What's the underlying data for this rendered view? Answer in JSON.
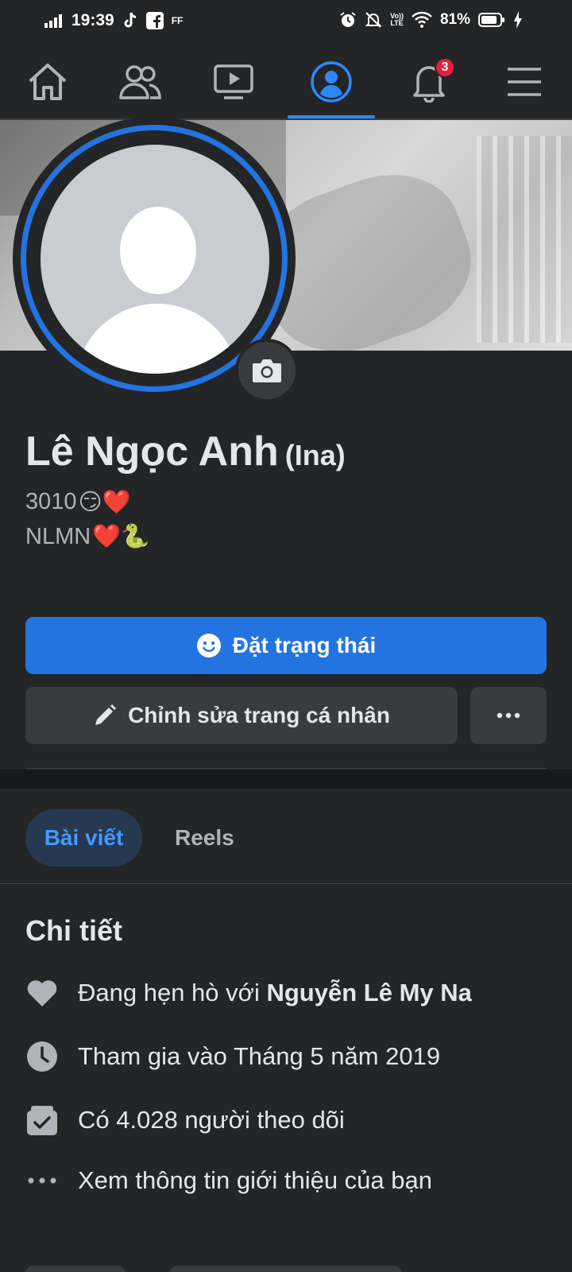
{
  "status_bar": {
    "time": "19:39",
    "app_badge": "FF",
    "network": "LTE",
    "battery": "81%"
  },
  "nav": {
    "notifications_count": "3",
    "active_tab": "profile"
  },
  "profile": {
    "name": "Lê Ngọc Anh",
    "alt_name": "(Ina)",
    "bio_line1_text": "3010",
    "bio_line1_emoji": "😏❤️",
    "bio_line2_text": "NLMN",
    "bio_line2_emoji": "❤️🐍"
  },
  "actions": {
    "primary_label": "Đặt trạng thái",
    "edit_label": "Chỉnh sửa trang cá nhân"
  },
  "tabs": {
    "posts": "Bài viết",
    "reels": "Reels"
  },
  "details": {
    "title": "Chi tiết",
    "relationship_prefix": "Đang hẹn hò với ",
    "relationship_name": "Nguyễn Lê My Na",
    "joined": "Tham gia vào Tháng 5 năm 2019",
    "followers": "Có 4.028 người theo dõi",
    "see_about": "Xem thông tin giới thiệu của bạn"
  },
  "colors": {
    "accent": "#2374e1",
    "background": "#242526",
    "badge": "#e41e3f"
  }
}
